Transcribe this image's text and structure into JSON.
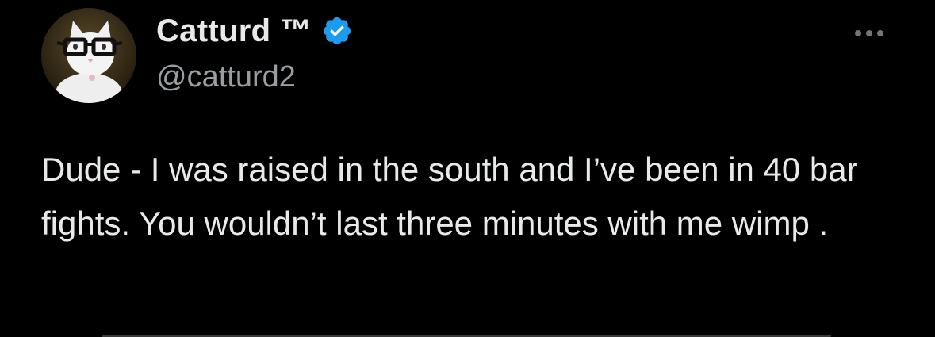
{
  "tweet": {
    "author": {
      "display_name": "Catturd ™",
      "handle": "@catturd2",
      "verified": true,
      "verified_color": "#1d9bf0",
      "avatar_icon": "cat-with-glasses-avatar"
    },
    "text": "Dude - I was raised in the south and I’ve been in 40 bar fights. You wouldn’t last three minutes with me wimp .",
    "more_icon": "more-horizontal-icon"
  },
  "theme": {
    "background": "#000000",
    "text_color": "#e7e9ea",
    "secondary_text_color": "#9a9da1"
  }
}
